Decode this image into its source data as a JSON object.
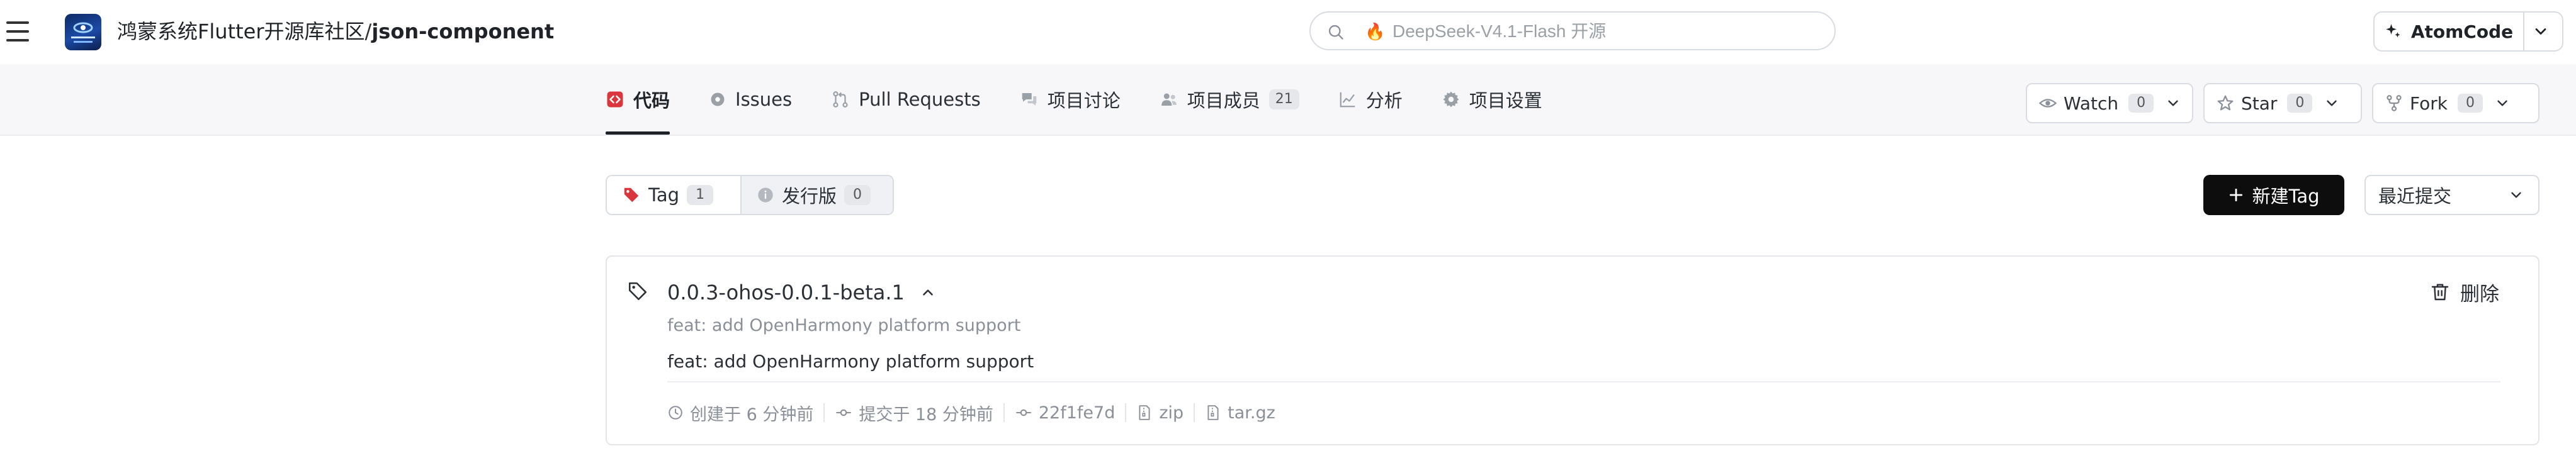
{
  "header": {
    "org": "鸿蒙系统Flutter开源库社区",
    "separator": "/",
    "repo": "json-component",
    "search_placeholder": "DeepSeek-V4.1-Flash 开源",
    "atom_label": "AtomCode"
  },
  "nav": {
    "tabs": [
      {
        "label": "代码",
        "active": true
      },
      {
        "label": "Issues"
      },
      {
        "label": "Pull Requests"
      },
      {
        "label": "项目讨论"
      },
      {
        "label": "项目成员",
        "badge": "21"
      },
      {
        "label": "分析"
      },
      {
        "label": "项目设置"
      }
    ],
    "watch": {
      "label": "Watch",
      "count": "0"
    },
    "star": {
      "label": "Star",
      "count": "0"
    },
    "fork": {
      "label": "Fork",
      "count": "0"
    }
  },
  "toolbar": {
    "tag_label": "Tag",
    "tag_count": "1",
    "release_label": "发行版",
    "release_count": "0",
    "new_tag_label": "新建Tag",
    "sort_label": "最近提交"
  },
  "tag_item": {
    "name": "0.0.3-ohos-0.0.1-beta.1",
    "subtitle": "feat: add OpenHarmony platform support",
    "message": "feat: add OpenHarmony platform support",
    "delete_label": "删除",
    "created": "创建于 6 分钟前",
    "committed": "提交于 18 分钟前",
    "commit": "22f1fe7d",
    "zip": "zip",
    "targz": "tar.gz"
  },
  "colors": {
    "accent_red": "#d9363e",
    "button_dark": "#0d0d0d",
    "fire": "#ff5a1f"
  }
}
